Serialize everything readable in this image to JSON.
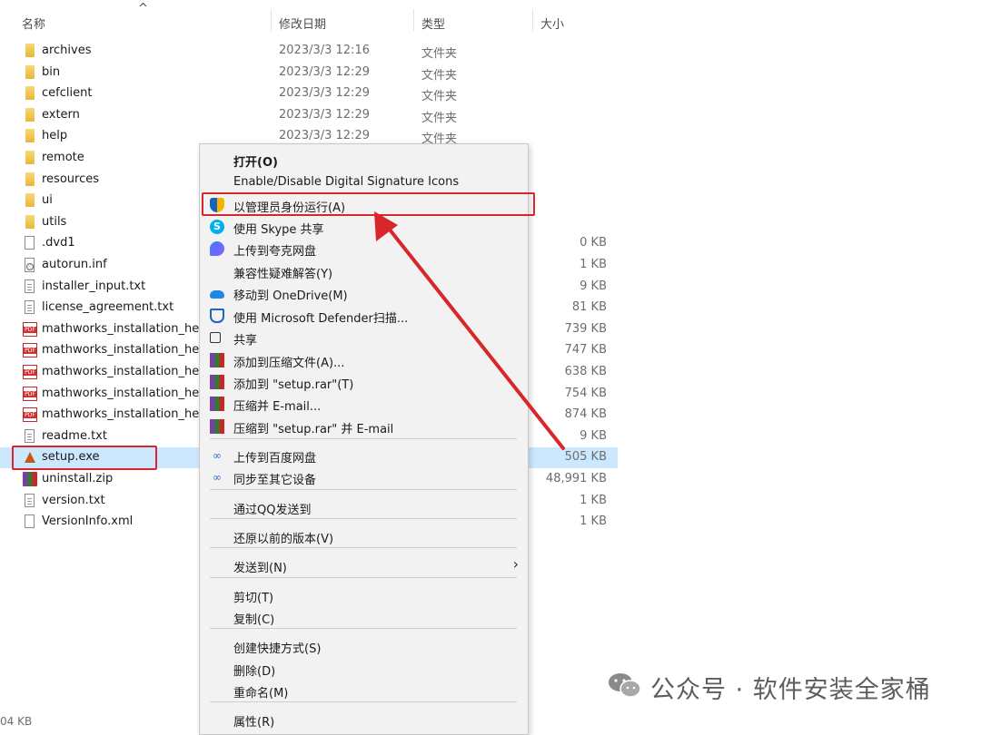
{
  "header": {
    "name": "名称",
    "date": "修改日期",
    "type": "类型",
    "size": "大小",
    "sort_arrow": "^"
  },
  "files": [
    {
      "name": "archives",
      "date": "2023/3/3 12:16",
      "type": "文件夹",
      "size": "",
      "icon": "folder-icon"
    },
    {
      "name": "bin",
      "date": "2023/3/3 12:29",
      "type": "文件夹",
      "size": "",
      "icon": "folder-icon"
    },
    {
      "name": "cefclient",
      "date": "2023/3/3 12:29",
      "type": "文件夹",
      "size": "",
      "icon": "folder-icon"
    },
    {
      "name": "extern",
      "date": "2023/3/3 12:29",
      "type": "文件夹",
      "size": "",
      "icon": "folder-icon"
    },
    {
      "name": "help",
      "date": "2023/3/3 12:29",
      "type": "文件夹",
      "size": "",
      "icon": "folder-icon"
    },
    {
      "name": "remote",
      "date": "",
      "type": "",
      "size": "",
      "icon": "folder-icon"
    },
    {
      "name": "resources",
      "date": "",
      "type": "",
      "size": "",
      "icon": "folder-icon"
    },
    {
      "name": "ui",
      "date": "",
      "type": "",
      "size": "",
      "icon": "folder-icon"
    },
    {
      "name": "utils",
      "date": "",
      "type": "",
      "size": "",
      "icon": "folder-icon"
    },
    {
      "name": ".dvd1",
      "date": "",
      "type": "",
      "size": "0 KB",
      "icon": "file-icon"
    },
    {
      "name": "autorun.inf",
      "date": "",
      "type": "",
      "size": "1 KB",
      "icon": "inf-file-icon"
    },
    {
      "name": "installer_input.txt",
      "date": "",
      "type": "",
      "size": "9 KB",
      "icon": "text-file-icon"
    },
    {
      "name": "license_agreement.txt",
      "date": "",
      "type": "",
      "size": "81 KB",
      "icon": "text-file-icon"
    },
    {
      "name": "mathworks_installation_help",
      "date": "",
      "type": "",
      "size": "739 KB",
      "icon": "pdf-icon"
    },
    {
      "name": "mathworks_installation_help",
      "date": "",
      "type": "",
      "size": "747 KB",
      "icon": "pdf-icon"
    },
    {
      "name": "mathworks_installation_help",
      "date": "",
      "type": "",
      "size": "638 KB",
      "icon": "pdf-icon"
    },
    {
      "name": "mathworks_installation_help",
      "date": "",
      "type": "",
      "size": "754 KB",
      "icon": "pdf-icon"
    },
    {
      "name": "mathworks_installation_help",
      "date": "",
      "type": "",
      "size": "874 KB",
      "icon": "pdf-icon"
    },
    {
      "name": "readme.txt",
      "date": "",
      "type": "",
      "size": "9 KB",
      "icon": "text-file-icon"
    },
    {
      "name": "setup.exe",
      "date": "",
      "type": "",
      "size": "505 KB",
      "icon": "matlab-exe-icon",
      "selected": true
    },
    {
      "name": "uninstall.zip",
      "date": "",
      "type": "",
      "size": "48,991 KB",
      "icon": "archive-icon"
    },
    {
      "name": "version.txt",
      "date": "",
      "type": "",
      "size": "1 KB",
      "icon": "text-file-icon"
    },
    {
      "name": "VersionInfo.xml",
      "date": "",
      "type": "",
      "size": "1 KB",
      "icon": "file-icon"
    }
  ],
  "context_menu": {
    "items": [
      {
        "label": "打开(O)",
        "bold": true,
        "icon": ""
      },
      {
        "label": "Enable/Disable Digital Signature Icons",
        "icon": ""
      },
      {
        "label": "以管理员身份运行(A)",
        "icon": "uac-shield-icon",
        "highlighted": true
      },
      {
        "label": "使用 Skype 共享",
        "icon": "skype-icon"
      },
      {
        "label": "上传到夸克网盘",
        "icon": "quark-icon"
      },
      {
        "label": "兼容性疑难解答(Y)",
        "icon": ""
      },
      {
        "label": "移动到 OneDrive(M)",
        "icon": "onedrive-icon"
      },
      {
        "label": "使用 Microsoft Defender扫描...",
        "icon": "defender-icon"
      },
      {
        "label": "共享",
        "icon": "share-icon"
      },
      {
        "label": "添加到压缩文件(A)...",
        "icon": "winrar-icon"
      },
      {
        "label": "添加到 \"setup.rar\"(T)",
        "icon": "winrar-icon"
      },
      {
        "label": "压缩并 E-mail...",
        "icon": "winrar-icon"
      },
      {
        "label": "压缩到 \"setup.rar\" 并 E-mail",
        "icon": "winrar-icon"
      },
      {
        "label": "上传到百度网盘",
        "icon": "baidu-icon"
      },
      {
        "label": "同步至其它设备",
        "icon": "baidu-icon"
      },
      {
        "label": "通过QQ发送到",
        "icon": ""
      },
      {
        "label": "还原以前的版本(V)",
        "icon": ""
      },
      {
        "label": "发送到(N)",
        "icon": "",
        "submenu": true
      },
      {
        "label": "剪切(T)",
        "icon": ""
      },
      {
        "label": "复制(C)",
        "icon": ""
      },
      {
        "label": "创建快捷方式(S)",
        "icon": ""
      },
      {
        "label": "删除(D)",
        "icon": ""
      },
      {
        "label": "重命名(M)",
        "icon": ""
      },
      {
        "label": "属性(R)",
        "icon": ""
      }
    ]
  },
  "watermark": {
    "text": "公众号 · 软件安装全家桶",
    "icon": "wechat-icon"
  },
  "footer": {
    "cut_text": "04 KB"
  },
  "colors": {
    "selection": "#cce8ff",
    "annotation_red": "#d9262c"
  }
}
